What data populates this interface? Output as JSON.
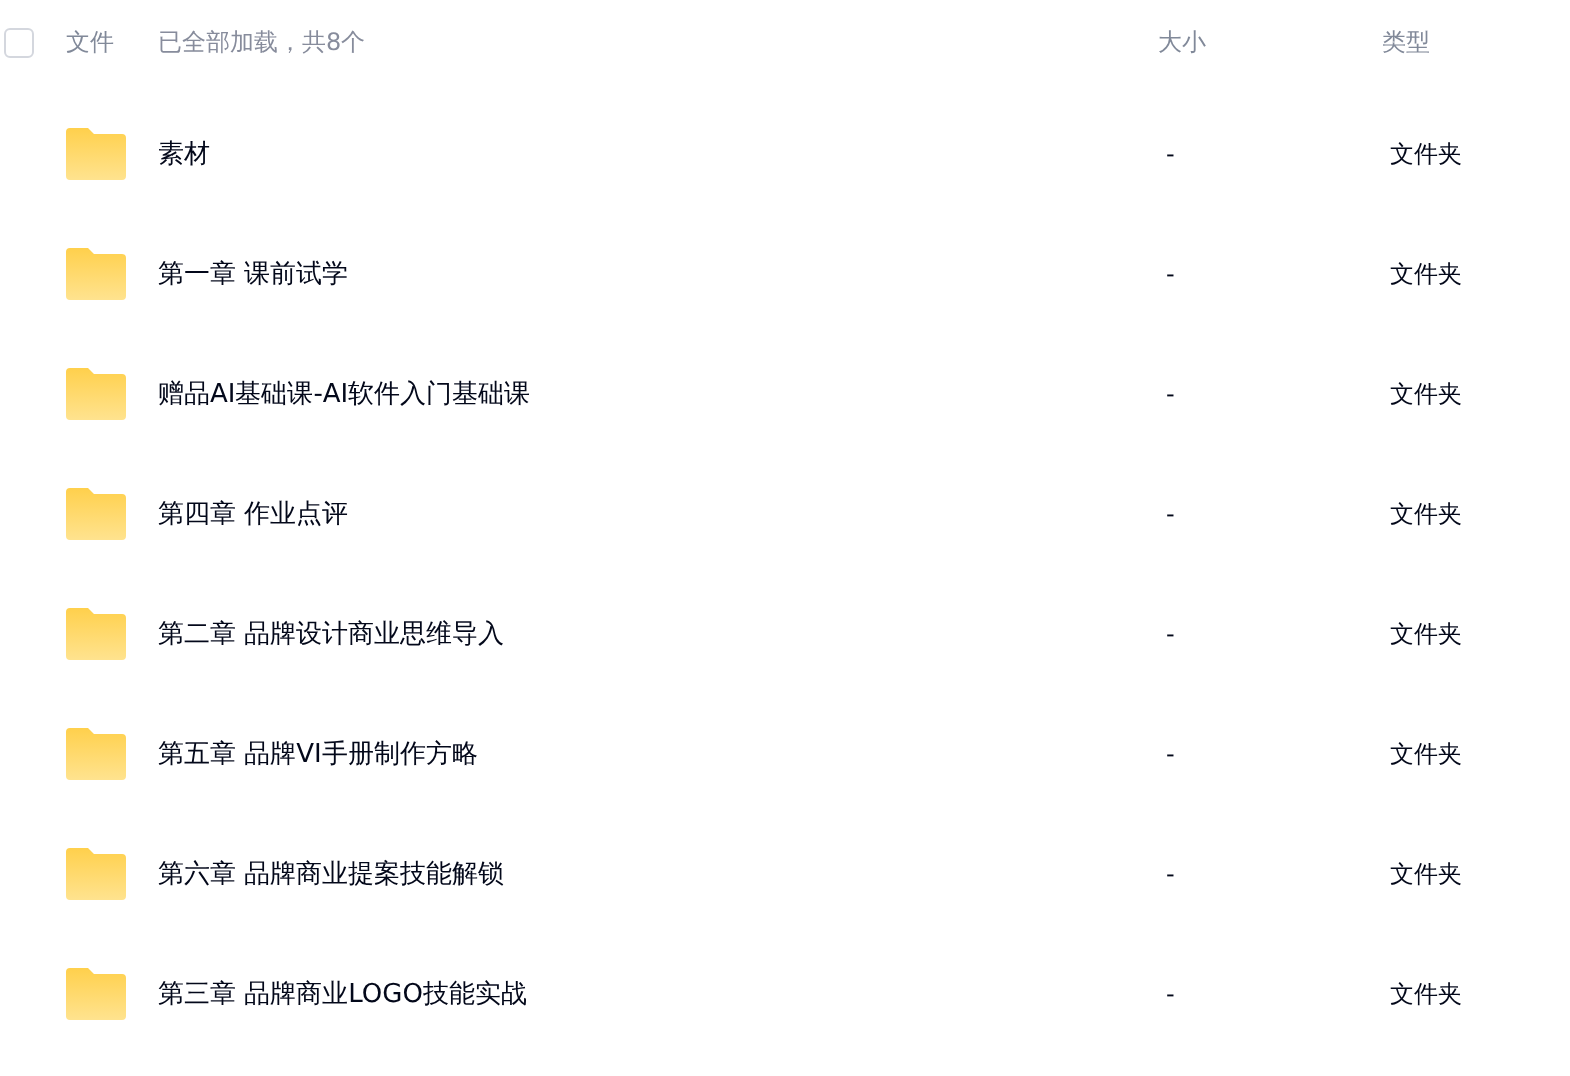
{
  "header": {
    "select_all": {
      "checked": false
    },
    "name_column": "文件",
    "load_status": "已全部加载，共8个",
    "size_column": "大小",
    "type_column": "类型"
  },
  "files": [
    {
      "name": "素材",
      "size": "-",
      "type": "文件夹"
    },
    {
      "name": "第一章 课前试学",
      "size": "-",
      "type": "文件夹"
    },
    {
      "name": "赠品AI基础课-AI软件入门基础课",
      "size": "-",
      "type": "文件夹"
    },
    {
      "name": "第四章 作业点评",
      "size": "-",
      "type": "文件夹"
    },
    {
      "name": "第二章 品牌设计商业思维导入",
      "size": "-",
      "type": "文件夹"
    },
    {
      "name": "第五章 品牌VI手册制作方略",
      "size": "-",
      "type": "文件夹"
    },
    {
      "name": "第六章 品牌商业提案技能解锁",
      "size": "-",
      "type": "文件夹"
    },
    {
      "name": "第三章 品牌商业LOGO技能实战",
      "size": "-",
      "type": "文件夹"
    }
  ]
}
